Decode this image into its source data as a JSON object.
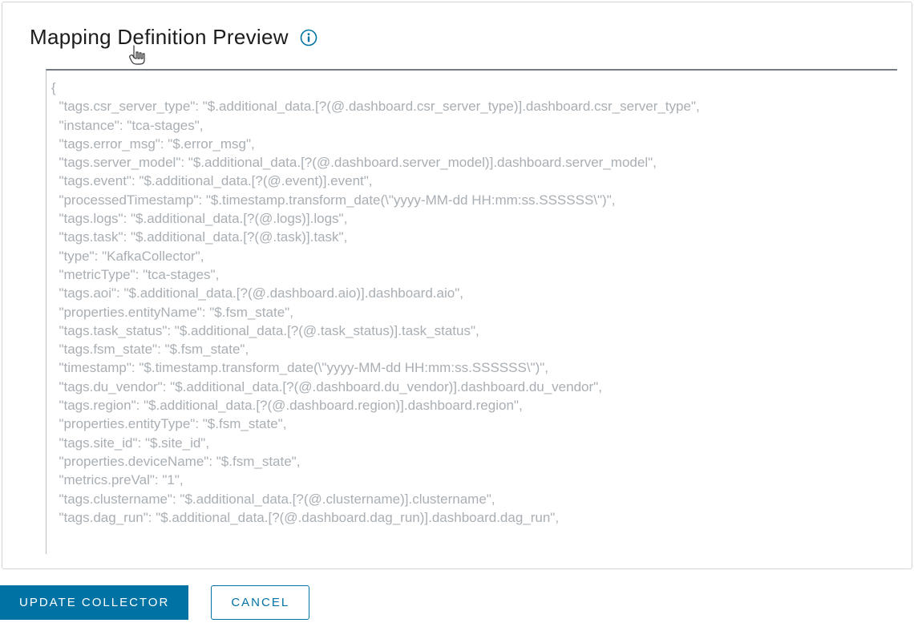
{
  "header": {
    "title": "Mapping Definition Preview"
  },
  "preview": {
    "lines": [
      "{",
      "  \"tags.csr_server_type\": \"$.additional_data.[?(@.dashboard.csr_server_type)].dashboard.csr_server_type\",",
      "  \"instance\": \"tca-stages\",",
      "  \"tags.error_msg\": \"$.error_msg\",",
      "  \"tags.server_model\": \"$.additional_data.[?(@.dashboard.server_model)].dashboard.server_model\",",
      "  \"tags.event\": \"$.additional_data.[?(@.event)].event\",",
      "  \"processedTimestamp\": \"$.timestamp.transform_date(\\\"yyyy-MM-dd HH:mm:ss.SSSSSS\\\")\",",
      "  \"tags.logs\": \"$.additional_data.[?(@.logs)].logs\",",
      "  \"tags.task\": \"$.additional_data.[?(@.task)].task\",",
      "  \"type\": \"KafkaCollector\",",
      "  \"metricType\": \"tca-stages\",",
      "  \"tags.aoi\": \"$.additional_data.[?(@.dashboard.aio)].dashboard.aio\",",
      "  \"properties.entityName\": \"$.fsm_state\",",
      "  \"tags.task_status\": \"$.additional_data.[?(@.task_status)].task_status\",",
      "  \"tags.fsm_state\": \"$.fsm_state\",",
      "  \"timestamp\": \"$.timestamp.transform_date(\\\"yyyy-MM-dd HH:mm:ss.SSSSSS\\\")\",",
      "  \"tags.du_vendor\": \"$.additional_data.[?(@.dashboard.du_vendor)].dashboard.du_vendor\",",
      "  \"tags.region\": \"$.additional_data.[?(@.dashboard.region)].dashboard.region\",",
      "  \"properties.entityType\": \"$.fsm_state\",",
      "  \"tags.site_id\": \"$.site_id\",",
      "  \"properties.deviceName\": \"$.fsm_state\",",
      "  \"metrics.preVal\": \"1\",",
      "  \"tags.clustername\": \"$.additional_data.[?(@.clustername)].clustername\",",
      "  \"tags.dag_run\": \"$.additional_data.[?(@.dashboard.dag_run)].dashboard.dag_run\","
    ]
  },
  "buttons": {
    "update": "UPDATE COLLECTOR",
    "cancel": "CANCEL"
  }
}
